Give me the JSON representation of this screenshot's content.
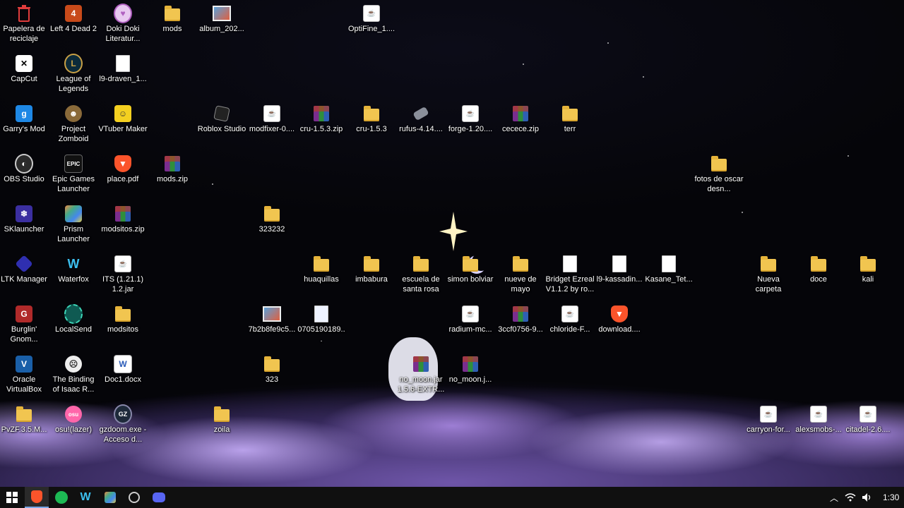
{
  "desktop": {
    "icons": [
      {
        "label": "Papelera de reciclaje",
        "icon": "recycle-bin-icon"
      },
      {
        "label": "Left 4 Dead 2",
        "icon": "left4dead-icon"
      },
      {
        "label": "Doki Doki Literatur...",
        "icon": "doki-doki-icon"
      },
      {
        "label": "mods",
        "icon": "folder-icon"
      },
      {
        "label": "album_202...",
        "icon": "image-file-icon"
      },
      {
        "label": "OptiFine_1....",
        "icon": "java-file-icon"
      },
      {
        "label": "CapCut",
        "icon": "capcut-icon"
      },
      {
        "label": "League of Legends",
        "icon": "league-icon"
      },
      {
        "label": "l9-draven_1...",
        "icon": "file-icon"
      },
      {
        "label": "Garry's Mod",
        "icon": "garrys-mod-icon"
      },
      {
        "label": "Project Zomboid",
        "icon": "project-zomboid-icon"
      },
      {
        "label": "VTuber Maker",
        "icon": "vtuber-maker-icon"
      },
      {
        "label": "Roblox Studio",
        "icon": "roblox-studio-icon"
      },
      {
        "label": "modfixer-0....",
        "icon": "java-file-icon"
      },
      {
        "label": "cru-1.5.3.zip",
        "icon": "winrar-icon"
      },
      {
        "label": "cru-1.5.3",
        "icon": "folder-icon"
      },
      {
        "label": "rufus-4.14....",
        "icon": "rufus-icon"
      },
      {
        "label": "forge-1.20....",
        "icon": "java-file-icon"
      },
      {
        "label": "cecece.zip",
        "icon": "winrar-icon"
      },
      {
        "label": "terr",
        "icon": "folder-icon"
      },
      {
        "label": "OBS Studio",
        "icon": "obs-icon"
      },
      {
        "label": "Epic Games Launcher",
        "icon": "epic-games-icon"
      },
      {
        "label": "place.pdf",
        "icon": "brave-pdf-icon"
      },
      {
        "label": "mods.zip",
        "icon": "winrar-icon"
      },
      {
        "label": "fotos de oscar desn...",
        "icon": "folder-icon"
      },
      {
        "label": "SKlauncher",
        "icon": "sklauncher-icon"
      },
      {
        "label": "Prism Launcher",
        "icon": "prism-launcher-icon"
      },
      {
        "label": "modsitos.zip",
        "icon": "winrar-icon"
      },
      {
        "label": "323232",
        "icon": "folder-icon"
      },
      {
        "label": "LTK Manager",
        "icon": "ltk-manager-icon"
      },
      {
        "label": "Waterfox",
        "icon": "waterfox-icon"
      },
      {
        "label": "ITS (1.21.1) 1.2.jar",
        "icon": "java-file-icon"
      },
      {
        "label": "huaquillas",
        "icon": "folder-icon"
      },
      {
        "label": "imbabura",
        "icon": "folder-icon"
      },
      {
        "label": "escuela de santa rosa",
        "icon": "folder-icon"
      },
      {
        "label": "simon bolviar",
        "icon": "folder-icon"
      },
      {
        "label": "nueve de mayo",
        "icon": "folder-icon"
      },
      {
        "label": "Bridget Ezreal V1.1.2 by ro...",
        "icon": "file-icon"
      },
      {
        "label": "l9-kassadin...",
        "icon": "file-icon"
      },
      {
        "label": "Kasane_Tet...",
        "icon": "file-icon"
      },
      {
        "label": "Nueva carpeta",
        "icon": "folder-icon"
      },
      {
        "label": "doce",
        "icon": "folder-icon"
      },
      {
        "label": "kali",
        "icon": "folder-icon"
      },
      {
        "label": "Burglin' Gnom...",
        "icon": "burglin-gnomes-icon"
      },
      {
        "label": "LocalSend",
        "icon": "localsend-icon"
      },
      {
        "label": "modsitos",
        "icon": "folder-icon"
      },
      {
        "label": "7b2b8fe9c5...",
        "icon": "image-file-icon"
      },
      {
        "label": "0705190189...",
        "icon": "document-file-icon"
      },
      {
        "label": "radium-mc...",
        "icon": "java-file-icon"
      },
      {
        "label": "3ccf0756-9...",
        "icon": "winrar-icon"
      },
      {
        "label": "chloride-F...",
        "icon": "java-file-icon"
      },
      {
        "label": "download....",
        "icon": "brave-pdf-icon"
      },
      {
        "label": "Oracle VirtualBox",
        "icon": "virtualbox-icon"
      },
      {
        "label": "The Binding of Isaac R...",
        "icon": "isaac-icon"
      },
      {
        "label": "Doc1.docx",
        "icon": "word-icon"
      },
      {
        "label": "323",
        "icon": "folder-icon"
      },
      {
        "label": "no_moon.jar 1.5.6-EXTR...",
        "icon": "winrar-icon"
      },
      {
        "label": "no_moon.j...",
        "icon": "winrar-icon"
      },
      {
        "label": "PvZF.3.5.M...",
        "icon": "folder-icon"
      },
      {
        "label": "osu!(lazer)",
        "icon": "osu-icon"
      },
      {
        "label": "gzdoom.exe - Acceso d...",
        "icon": "gzdoom-icon"
      },
      {
        "label": "zoila",
        "icon": "folder-icon"
      },
      {
        "label": "carryon-for...",
        "icon": "java-file-icon"
      },
      {
        "label": "alexsmobs-...",
        "icon": "java-file-icon"
      },
      {
        "label": "citadel-2.6....",
        "icon": "java-file-icon"
      }
    ]
  },
  "taskbar": {
    "apps": [
      {
        "icon": "windows-start-icon"
      },
      {
        "icon": "brave-icon",
        "active": true
      },
      {
        "icon": "spotify-icon"
      },
      {
        "icon": "waterfox-icon"
      },
      {
        "icon": "prism-launcher-icon"
      },
      {
        "icon": "obs-icon"
      },
      {
        "icon": "discord-icon"
      }
    ],
    "tray": {
      "icons": [
        "chevron-up-icon",
        "wifi-icon",
        "speaker-icon"
      ],
      "clock": "1:30"
    }
  },
  "colors": {
    "taskbar": "#101010",
    "folder": "#f1c550",
    "accent": "#7aa7e8"
  }
}
